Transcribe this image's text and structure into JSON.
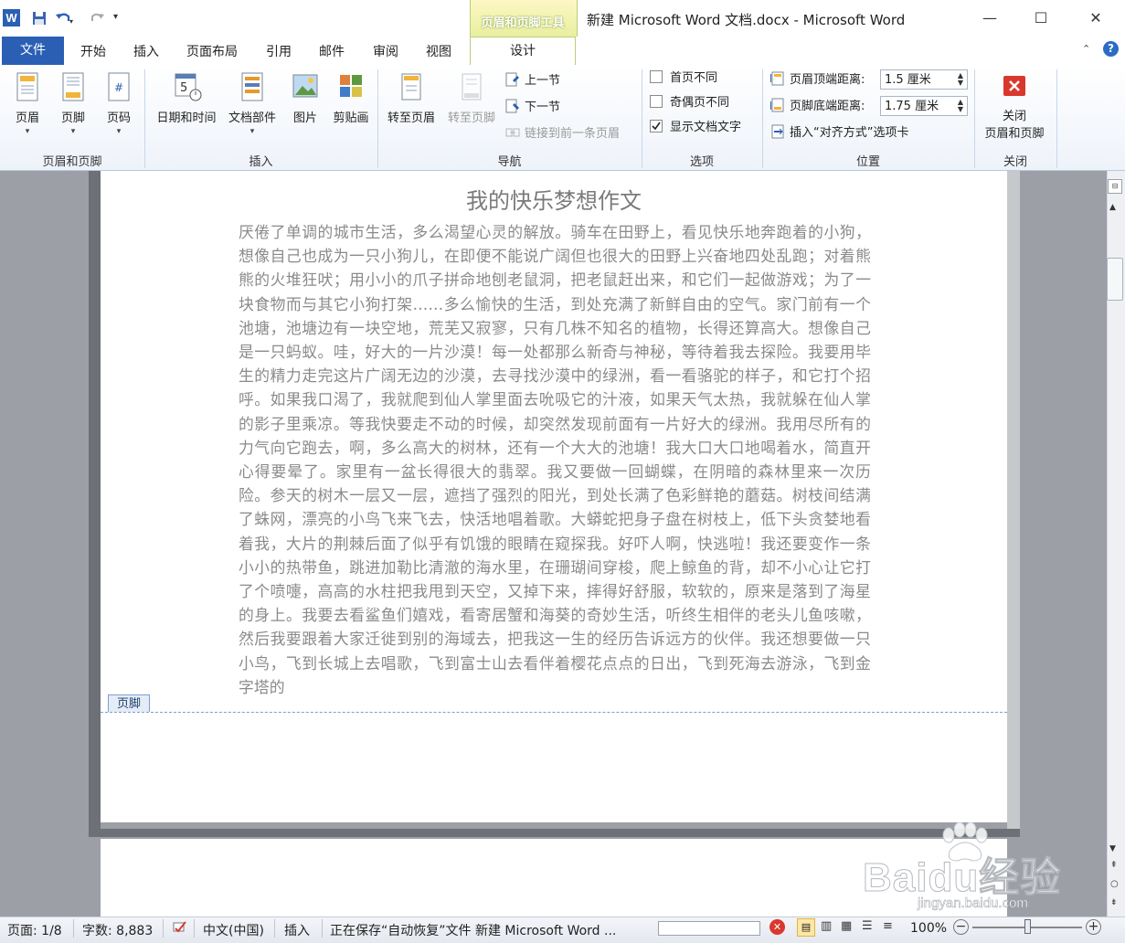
{
  "title_bar": {
    "window_title": "新建 Microsoft Word 文档.docx - Microsoft Word",
    "contextual_tab_group": "页眉和页脚工具",
    "minimize": "—",
    "maximize": "☐",
    "close": "✕"
  },
  "tabs": {
    "file": "文件",
    "items": [
      "开始",
      "插入",
      "页面布局",
      "引用",
      "邮件",
      "审阅",
      "视图"
    ],
    "design": "设计"
  },
  "ribbon": {
    "group_header_footer": {
      "label": "页眉和页脚",
      "header": "页眉",
      "footer": "页脚",
      "page_number": "页码"
    },
    "group_insert": {
      "label": "插入",
      "date_time": "日期和时间",
      "doc_parts": "文档部件",
      "picture": "图片",
      "clip_art": "剪贴画"
    },
    "group_navigation": {
      "label": "导航",
      "goto_header": "转至页眉",
      "goto_footer": "转至页脚",
      "prev_section": "上一节",
      "next_section": "下一节",
      "link_previous": "链接到前一条页眉"
    },
    "group_options": {
      "label": "选项",
      "different_first_page": "首页不同",
      "different_odd_even": "奇偶页不同",
      "show_document_text": "显示文档文字",
      "different_first_page_checked": false,
      "different_odd_even_checked": false,
      "show_document_text_checked": true
    },
    "group_position": {
      "label": "位置",
      "header_top_label": "页眉顶端距离:",
      "header_top_value": "1.5 厘米",
      "footer_bottom_label": "页脚底端距离:",
      "footer_bottom_value": "1.75 厘米",
      "insert_alignment_tab": "插入“对齐方式”选项卡"
    },
    "group_close": {
      "label": "关闭",
      "close_line1": "关闭",
      "close_line2": "页眉和页脚"
    }
  },
  "document": {
    "title": "我的快乐梦想作文",
    "body": "厌倦了单调的城市生活，多么渴望心灵的解放。骑车在田野上，看见快乐地奔跑着的小狗，想像自己也成为一只小狗儿，在即便不能说广阔但也很大的田野上兴奋地四处乱跑；对着熊熊的火堆狂吠；用小小的爪子拼命地刨老鼠洞，把老鼠赶出来，和它们一起做游戏；为了一块食物而与其它小狗打架……多么愉快的生活，到处充满了新鲜自由的空气。家门前有一个池塘，池塘边有一块空地，荒芜又寂寥，只有几株不知名的植物，长得还算高大。想像自己是一只蚂蚁。哇，好大的一片沙漠！每一处都那么新奇与神秘，等待着我去探险。我要用毕生的精力走完这片广阔无边的沙漠，去寻找沙漠中的绿洲，看一看骆驼的样子，和它打个招呼。如果我口渴了，我就爬到仙人掌里面去吮吸它的汁液，如果天气太热，我就躲在仙人掌的影子里乘凉。等我快要走不动的时候，却突然发现前面有一片好大的绿洲。我用尽所有的力气向它跑去，啊，多么高大的树林，还有一个大大的池塘！我大口大口地喝着水，简直开心得要晕了。家里有一盆长得很大的翡翠。我又要做一回蝴蝶，在阴暗的森林里来一次历险。参天的树木一层又一层，遮挡了强烈的阳光，到处长满了色彩鲜艳的蘑菇。树枝间结满了蛛网，漂亮的小鸟飞来飞去，快活地唱着歌。大蟒蛇把身子盘在树枝上，低下头贪婪地看着我，大片的荆棘后面了似乎有饥饿的眼睛在窥探我。好吓人啊，快逃啦！我还要变作一条小小的热带鱼，跳进加勒比清澈的海水里，在珊瑚间穿梭，爬上鲸鱼的背，却不小心让它打了个喷嚏，高高的水柱把我甩到天空，又掉下来，摔得好舒服，软软的，原来是落到了海星的身上。我要去看鲨鱼们嬉戏，看寄居蟹和海葵的奇妙生活，听终生相伴的老头儿鱼咳嗽，然后我要跟着大家迁徙到别的海域去，把我这一生的经历告诉远方的伙伴。我还想要做一只小鸟，飞到长城上去唱歌，飞到富士山去看伴着樱花点点的日出，飞到死海去游泳，飞到金字塔的",
    "footer_tag": "页脚"
  },
  "status_bar": {
    "page": "页面: 1/8",
    "word_count": "字数: 8,883",
    "language": "中文(中国)",
    "insert_mode": "插入",
    "saving": "正在保存“自动恢复”文件 新建 Microsoft Word ...",
    "zoom": "100%"
  },
  "watermark": {
    "brand": "Baidu经验",
    "url": "jingyan.baidu.com"
  },
  "colors": {
    "file_tab": "#2b5fb4",
    "contextual": "#e8efa0",
    "page_bg": "#9c9fa6",
    "close_icon": "#d9382f"
  }
}
